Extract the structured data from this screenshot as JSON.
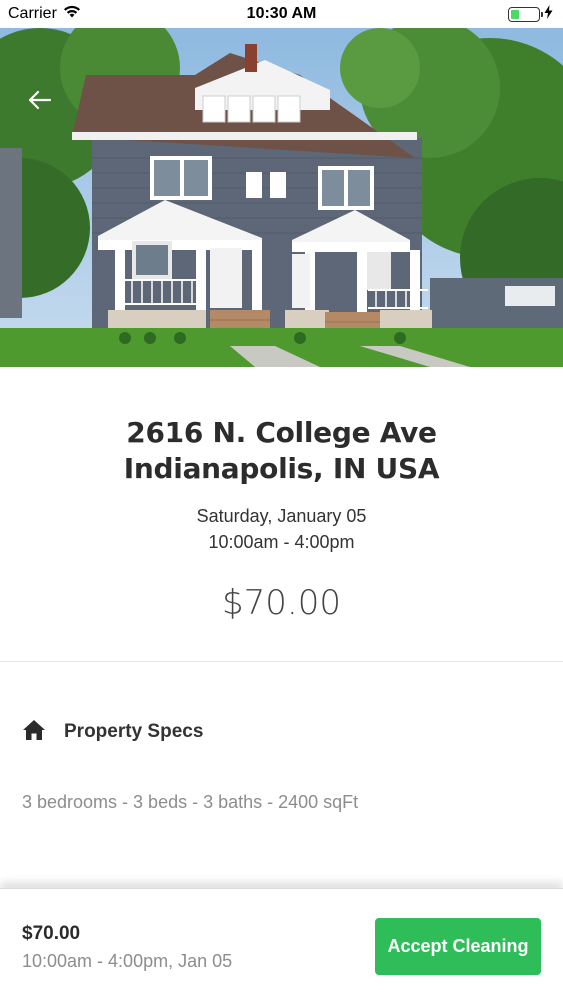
{
  "status_bar": {
    "carrier": "Carrier",
    "time": "10:30 AM",
    "battery_level": 0.3,
    "battery_color": "#4cd964"
  },
  "hero": {
    "back_icon": "arrow-left-icon"
  },
  "listing": {
    "address": "2616 N. College Ave Indianapolis, IN USA",
    "date": "Saturday, January 05",
    "time_range": "10:00am - 4:00pm",
    "price": "$70.00"
  },
  "specs": {
    "icon": "home-icon",
    "title": "Property Specs",
    "details": "3 bedrooms - 3 beds - 3 baths - 2400 sqFt"
  },
  "footer": {
    "price": "$70.00",
    "schedule": "10:00am - 4:00pm, Jan 05",
    "accept_label": "Accept Cleaning",
    "accent_color": "#2ebd59"
  }
}
